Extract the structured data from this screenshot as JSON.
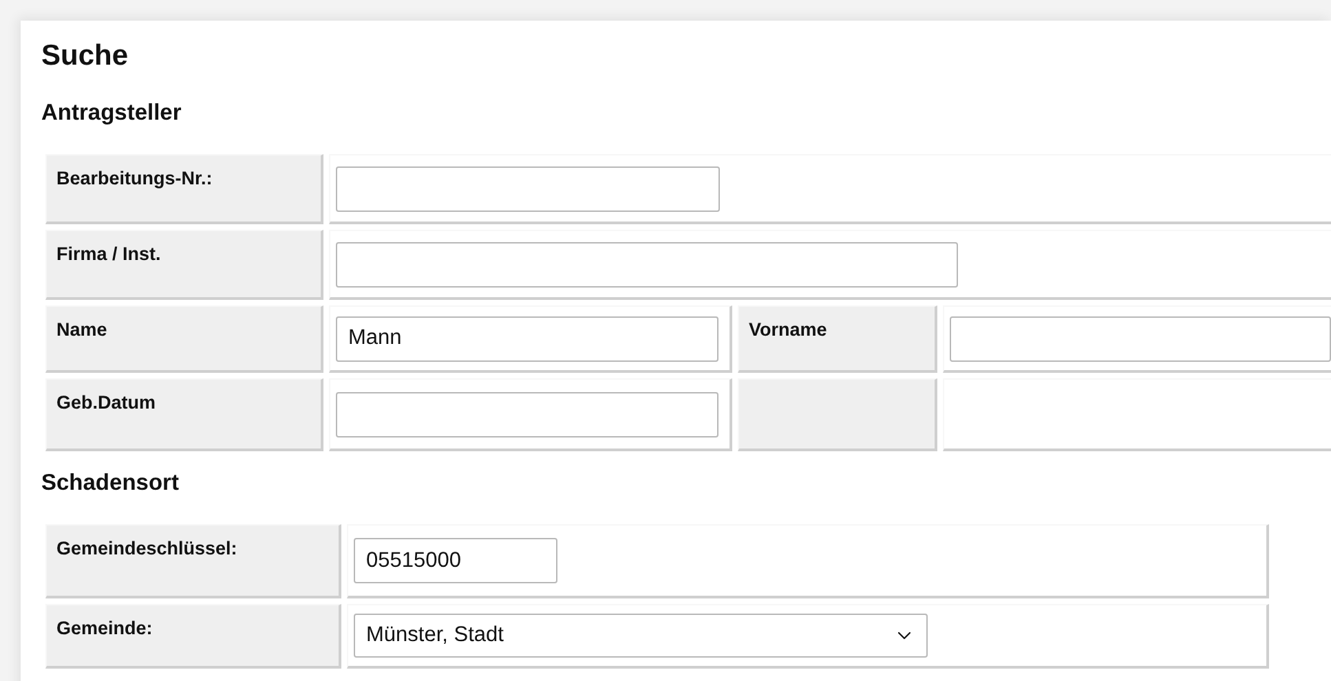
{
  "title": "Suche",
  "sections": [
    {
      "heading": "Antragsteller",
      "rows": [
        {
          "cells": [
            {
              "kind": "label",
              "text": "Bearbeitungs-Nr.:"
            },
            {
              "kind": "input"
            }
          ]
        },
        {
          "cells": [
            {
              "kind": "label",
              "text": "Firma / Inst."
            },
            {
              "kind": "input"
            }
          ]
        },
        {
          "cells": [
            {
              "kind": "label",
              "text": "Name"
            },
            {
              "kind": "input",
              "value": "Mann"
            },
            {
              "kind": "label",
              "text": "Vorname"
            },
            {
              "kind": "input"
            }
          ]
        },
        {
          "cells": [
            {
              "kind": "label",
              "text": "Geb.Datum"
            },
            {
              "kind": "input"
            },
            {
              "kind": "label"
            },
            {
              "kind": "blank"
            }
          ]
        }
      ]
    },
    {
      "heading": "Schadensort",
      "rows": [
        {
          "cells": [
            {
              "kind": "label",
              "text": "Gemeindeschlüssel:"
            },
            {
              "kind": "input",
              "value": "05515000"
            }
          ]
        },
        {
          "cells": [
            {
              "kind": "label",
              "text": "Gemeinde:"
            },
            {
              "kind": "select",
              "value": "Münster, Stadt"
            }
          ]
        }
      ]
    }
  ]
}
